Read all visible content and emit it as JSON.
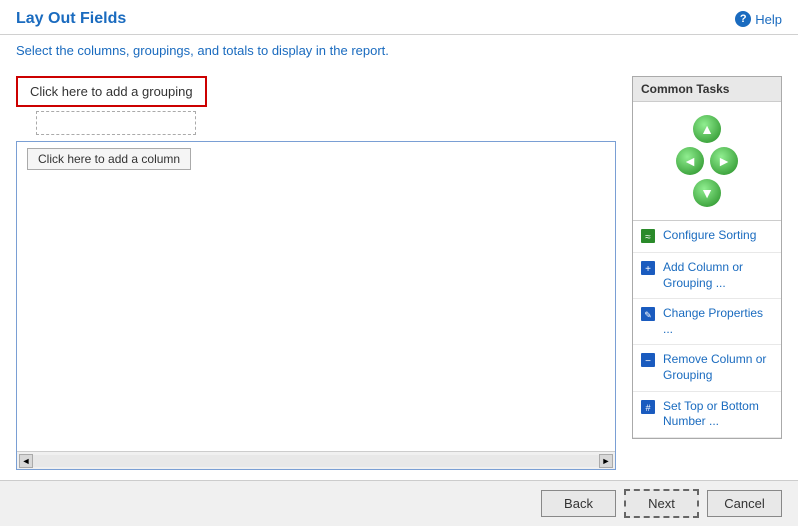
{
  "header": {
    "title": "Lay Out Fields",
    "help_label": "Help"
  },
  "subtitle": {
    "text_before": "Select the columns, groupings, and totals to ",
    "text_highlight": "display",
    "text_after": " in the report."
  },
  "left_panel": {
    "grouping_label": "Click here to add a grouping",
    "column_label": "Click here to add a column"
  },
  "common_tasks": {
    "title": "Common Tasks",
    "arrows": {
      "up": "▲",
      "left": "◄",
      "right": "►",
      "down": "▼"
    },
    "items": [
      {
        "label": "Configure Sorting",
        "icon": "sort-icon"
      },
      {
        "label": "Add Column or Grouping ...",
        "icon": "add-column-icon"
      },
      {
        "label": "Change Properties ...",
        "icon": "change-properties-icon"
      },
      {
        "label": "Remove Column or Grouping",
        "icon": "remove-column-icon"
      },
      {
        "label": "Set Top or Bottom Number ...",
        "icon": "set-top-bottom-icon"
      }
    ]
  },
  "footer": {
    "back_label": "Back",
    "next_label": "Next",
    "cancel_label": "Cancel"
  }
}
